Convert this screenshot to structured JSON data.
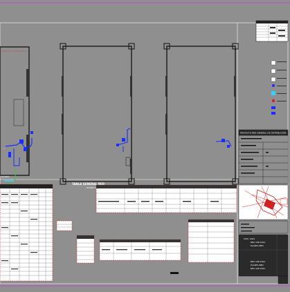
{
  "viewport": {
    "background": "#8f8f8f",
    "paper": "#8f8f8f",
    "line_color": "#ffffff",
    "accent": "#cc2222",
    "blue": "#1a2cff",
    "green": "#2ecc40",
    "cyan": "#39d0ff"
  },
  "sheet": {
    "plan_labels": [
      "PLANTA",
      "PLANTA BAJA PISO",
      "PLANTA SEGUNDO PISO"
    ],
    "section_title": "TABLA GENERAL RED",
    "title_block_header": "PROYECTO RED GENERAL DE DISTRIBUCION",
    "title_block_values": [
      "REA 108 2021",
      "PLANTA RED"
    ],
    "title_block_meta": [
      "COD. 2021",
      "REA 108 2021",
      "PLANTA RED",
      "REA 108 2021"
    ]
  }
}
